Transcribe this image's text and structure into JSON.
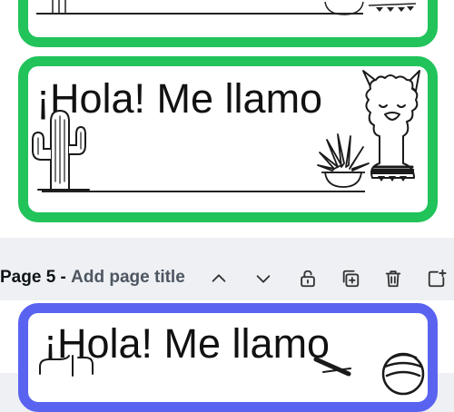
{
  "page_bar": {
    "page_label": "Page 5",
    "separator": "-",
    "title_placeholder": "Add page title",
    "tools": [
      "chevron-up-icon",
      "chevron-down-icon",
      "unlock-icon",
      "duplicate-page-icon",
      "trash-icon",
      "add-page-icon"
    ]
  },
  "cards": {
    "card_2": {
      "greeting": "¡Hola! Me llamo",
      "border_color": "#21c35a"
    },
    "card_3": {
      "greeting": "¡Hola! Me llamo",
      "border_color": "#5a63f0"
    }
  },
  "colors": {
    "workspace_bg": "#eef0f3",
    "green_border": "#21c35a",
    "blue_border": "#5a63f0"
  }
}
